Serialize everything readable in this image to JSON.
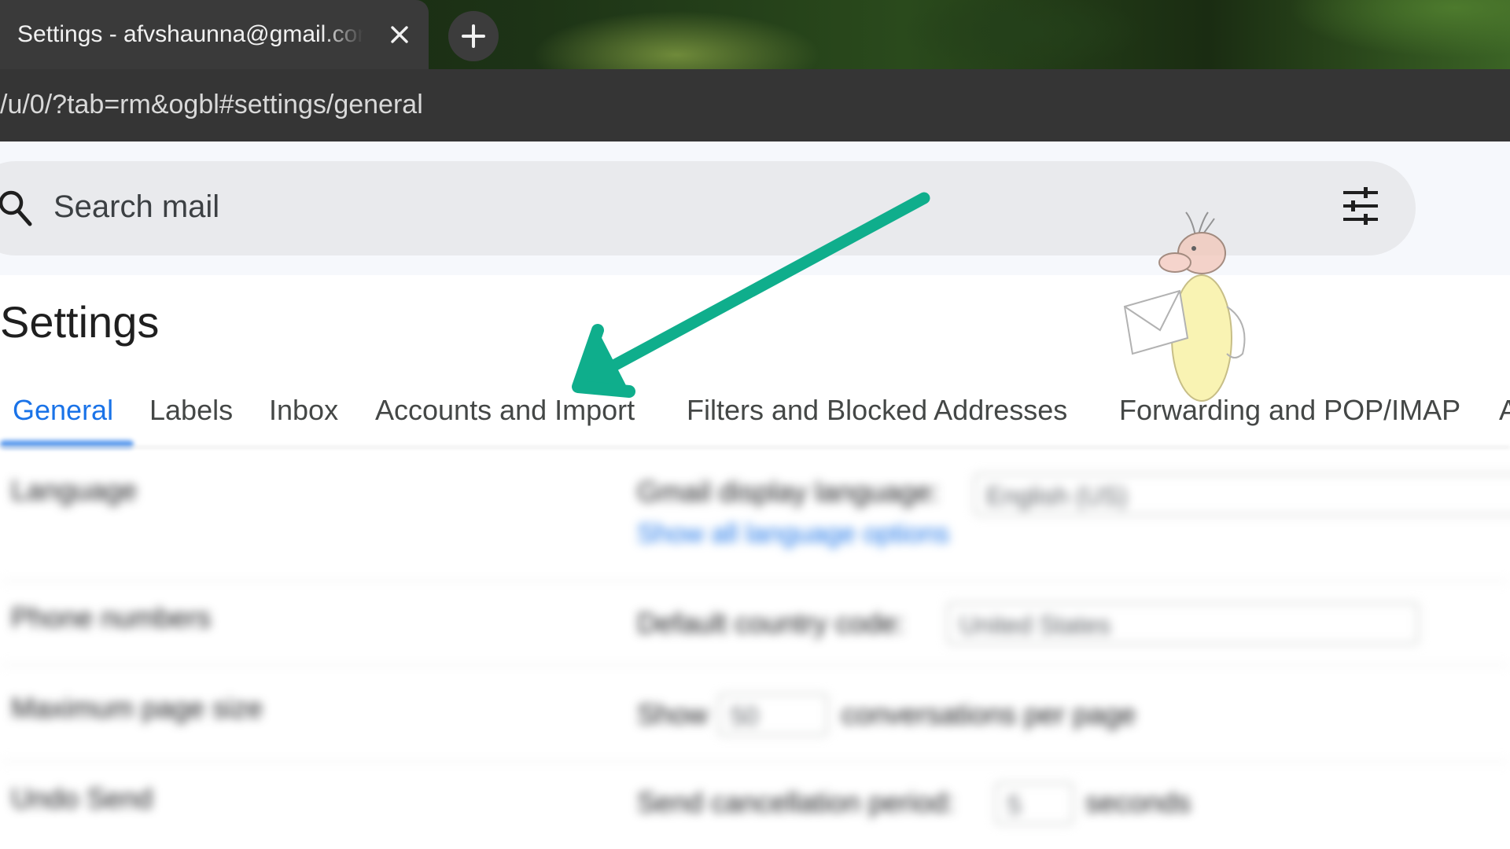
{
  "browser": {
    "tab_title": "Settings - afvshaunna@gmail.com",
    "close_glyph": "✕",
    "newtab_glyph": "+",
    "url": "/u/0/?tab=rm&ogbl#settings/general"
  },
  "search": {
    "placeholder": "Search mail",
    "icon": "search-icon",
    "filter_icon": "tune-icon"
  },
  "settings": {
    "title": "Settings",
    "tabs": [
      {
        "label": "General",
        "active": true
      },
      {
        "label": "Labels"
      },
      {
        "label": "Inbox"
      },
      {
        "label": "Accounts and Import"
      },
      {
        "label": "Filters and Blocked Addresses"
      },
      {
        "label": "Forwarding and POP/IMAP"
      },
      {
        "label": "A"
      }
    ],
    "rows": [
      {
        "label": "Language",
        "text": "Gmail display language:",
        "value": "English (US)",
        "link": "Show all language options"
      },
      {
        "label": "Phone numbers",
        "text": "Default country code:",
        "value": "United States"
      },
      {
        "label": "Maximum page size",
        "text": "Show",
        "value": "50",
        "suffix": "conversations per page"
      },
      {
        "label": "Undo Send",
        "text": "Send cancellation period:",
        "value": "5",
        "suffix": "seconds"
      }
    ]
  },
  "colors": {
    "accent": "#1a73e8",
    "annotation_arrow": "#0fae8c"
  }
}
